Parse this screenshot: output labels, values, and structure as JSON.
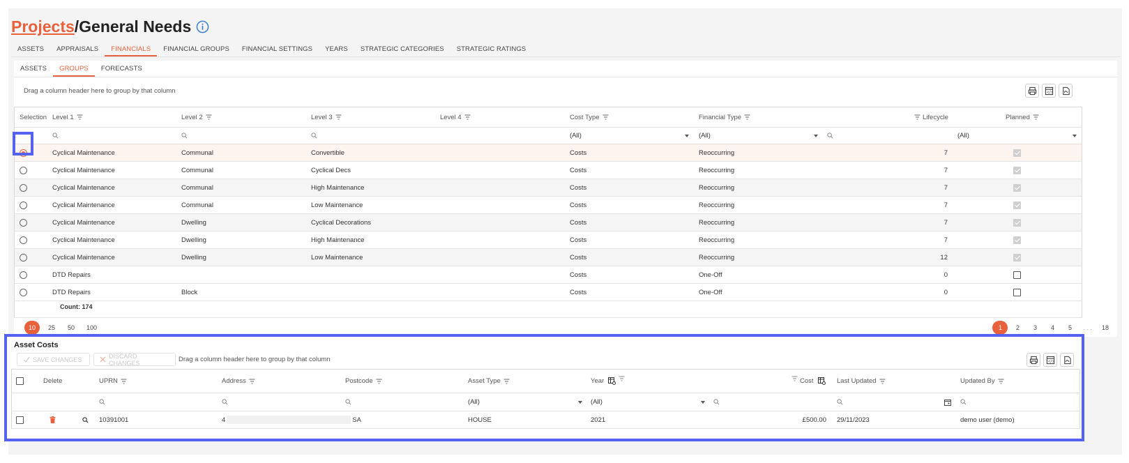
{
  "breadcrumb": {
    "link": "Projects",
    "separator": "/",
    "current": "General Needs"
  },
  "tabs": [
    {
      "label": "ASSETS"
    },
    {
      "label": "APPRAISALS"
    },
    {
      "label": "FINANCIALS",
      "active": true
    },
    {
      "label": "FINANCIAL GROUPS"
    },
    {
      "label": "FINANCIAL SETTINGS"
    },
    {
      "label": "YEARS"
    },
    {
      "label": "STRATEGIC CATEGORIES"
    },
    {
      "label": "STRATEGIC RATINGS"
    }
  ],
  "subtabs": [
    {
      "label": "ASSETS"
    },
    {
      "label": "GROUPS",
      "active": true
    },
    {
      "label": "FORECASTS"
    }
  ],
  "groups_grid": {
    "group_hint": "Drag a column header here to group by that column",
    "columns": {
      "selection": "Selection",
      "level1": "Level 1",
      "level2": "Level 2",
      "level3": "Level 3",
      "level4": "Level 4",
      "cost_type": "Cost Type",
      "financial_type": "Financial Type",
      "lifecycle": "Lifecycle",
      "planned": "Planned"
    },
    "filters": {
      "cost_type": "(All)",
      "financial_type": "(All)",
      "planned": "(All)"
    },
    "rows": [
      {
        "level1": "Cyclical Maintenance",
        "level2": "Communal",
        "level3": "Convertible",
        "level4": "",
        "cost_type": "Costs",
        "financial_type": "Reoccurring",
        "lifecycle": "7",
        "planned": true,
        "selected": true
      },
      {
        "level1": "Cyclical Maintenance",
        "level2": "Communal",
        "level3": "Cyclical Decs",
        "level4": "",
        "cost_type": "Costs",
        "financial_type": "Reoccurring",
        "lifecycle": "7",
        "planned": true
      },
      {
        "level1": "Cyclical Maintenance",
        "level2": "Communal",
        "level3": "High Maintenance",
        "level4": "",
        "cost_type": "Costs",
        "financial_type": "Reoccurring",
        "lifecycle": "7",
        "planned": true
      },
      {
        "level1": "Cyclical Maintenance",
        "level2": "Communal",
        "level3": "Low Maintenance",
        "level4": "",
        "cost_type": "Costs",
        "financial_type": "Reoccurring",
        "lifecycle": "7",
        "planned": true
      },
      {
        "level1": "Cyclical Maintenance",
        "level2": "Dwelling",
        "level3": "Cyclical Decorations",
        "level4": "",
        "cost_type": "Costs",
        "financial_type": "Reoccurring",
        "lifecycle": "7",
        "planned": true
      },
      {
        "level1": "Cyclical Maintenance",
        "level2": "Dwelling",
        "level3": "High Maintenance",
        "level4": "",
        "cost_type": "Costs",
        "financial_type": "Reoccurring",
        "lifecycle": "7",
        "planned": true
      },
      {
        "level1": "Cyclical Maintenance",
        "level2": "Dwelling",
        "level3": "Low Maintenance",
        "level4": "",
        "cost_type": "Costs",
        "financial_type": "Reoccurring",
        "lifecycle": "12",
        "planned": true
      },
      {
        "level1": "DTD Repairs",
        "level2": "",
        "level3": "",
        "level4": "",
        "cost_type": "Costs",
        "financial_type": "One-Off",
        "lifecycle": "0",
        "planned": false
      },
      {
        "level1": "DTD Repairs",
        "level2": "Block",
        "level3": "",
        "level4": "",
        "cost_type": "Costs",
        "financial_type": "One-Off",
        "lifecycle": "0",
        "planned": false
      }
    ],
    "count_label": "Count: 174",
    "page_sizes": [
      "10",
      "25",
      "50",
      "100"
    ],
    "active_page_size": "10",
    "pages": [
      "1",
      "2",
      "3",
      "4",
      "5",
      ". . .",
      "18"
    ],
    "current_page": "1"
  },
  "asset_costs": {
    "title": "Asset Costs",
    "save_changes": "SAVE CHANGES",
    "discard_changes": "DISCARD CHANGES",
    "group_hint": "Drag a column header here to group by that column",
    "columns": {
      "delete": "Delete",
      "uprn": "UPRN",
      "address": "Address",
      "postcode": "Postcode",
      "asset_type": "Asset Type",
      "year": "Year",
      "cost": "Cost",
      "last_updated": "Last Updated",
      "updated_by": "Updated By"
    },
    "filters": {
      "asset_type": "(All)",
      "year": "(All)"
    },
    "rows": [
      {
        "uprn": "10391001",
        "address_start": "4",
        "postcode_end": "SA",
        "asset_type": "HOUSE",
        "year": "2021",
        "cost": "£500.00",
        "last_updated": "29/11/2023",
        "updated_by": "demo user (demo)"
      }
    ]
  },
  "colors": {
    "accent": "#e8613c",
    "highlight": "#5561f0"
  },
  "icons": [
    "info-icon",
    "filter-icon",
    "search-icon",
    "print-icon",
    "export-icon",
    "pdf-icon",
    "trash-icon",
    "calendar-icon",
    "table-settings-icon",
    "check-icon",
    "x-icon"
  ]
}
